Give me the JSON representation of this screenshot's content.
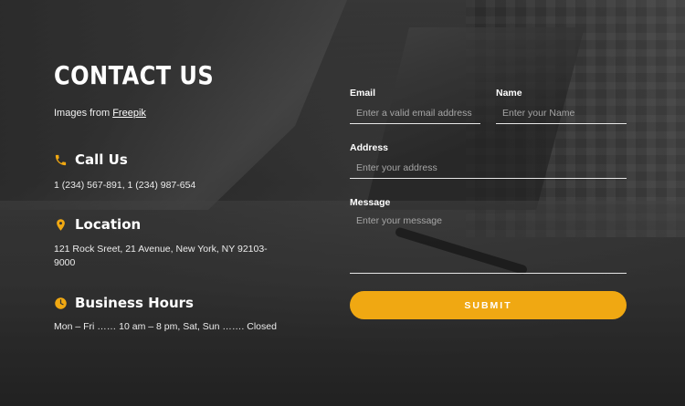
{
  "page": {
    "title": "CONTACT US",
    "credit_prefix": "Images from",
    "credit_link": "Freepik"
  },
  "contact": {
    "call": {
      "heading": "Call Us",
      "text": "1 (234) 567-891, 1 (234) 987-654",
      "icon": "phone-icon"
    },
    "location": {
      "heading": "Location",
      "text": "121 Rock Sreet, 21 Avenue, New York, NY 92103-9000",
      "icon": "location-pin-icon"
    },
    "hours": {
      "heading": "Business Hours",
      "text": "Mon – Fri …… 10 am – 8 pm, Sat, Sun ……. Closed",
      "icon": "clock-icon"
    }
  },
  "form": {
    "email": {
      "label": "Email",
      "placeholder": "Enter a valid email address",
      "value": ""
    },
    "name": {
      "label": "Name",
      "placeholder": "Enter your Name",
      "value": ""
    },
    "address": {
      "label": "Address",
      "placeholder": "Enter your address",
      "value": ""
    },
    "message": {
      "label": "Message",
      "placeholder": "Enter your message",
      "value": ""
    },
    "submit_label": "SUBMIT"
  },
  "colors": {
    "accent": "#f0a812",
    "text": "#ffffff"
  }
}
